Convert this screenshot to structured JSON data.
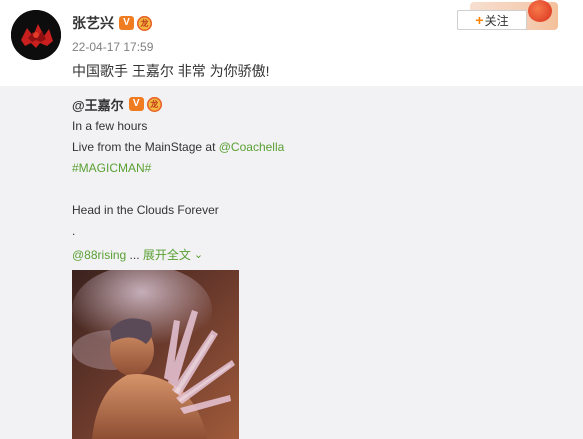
{
  "post": {
    "author": "张艺兴",
    "verified_badge": "V",
    "level_badge": "龙",
    "timestamp": "22-04-17 17:59",
    "text": "中国歌手 王嘉尔 非常 为你骄傲!",
    "follow_plus": "+",
    "follow_label": "关注"
  },
  "repost": {
    "author": "@王嘉尔",
    "verified_badge": "V",
    "level_badge": "龙",
    "line1": "In a few hours",
    "line2_prefix": "Live from the MainStage at ",
    "line2_mention": "@Coachella",
    "hashtag": "#MAGICMAN#",
    "line4": "Head in the Clouds Forever",
    "line5": ".",
    "mention_88rising": "@88rising",
    "ellipsis": " ... ",
    "expand_label": "展开全文",
    "expand_icon": "chevron-down-icon"
  },
  "colors": {
    "accent": "#eb7350",
    "link_green": "#5aa033",
    "verified_orange": "#f07c22",
    "repost_bg": "#f2f2f5",
    "text": "#333333",
    "meta": "#808080"
  }
}
